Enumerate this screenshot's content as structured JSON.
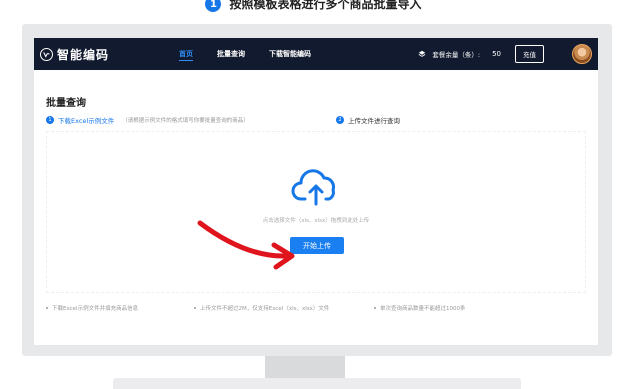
{
  "caption": {
    "number": "1",
    "text": "按照模板表格进行多个商品批量导入"
  },
  "nav": {
    "logo": "智能编码",
    "links": [
      "首页",
      "批量查询",
      "下载智能编码"
    ],
    "active_index": 0,
    "quota_label": "套餐余量（条）:",
    "quota_value": "50",
    "recharge": "充值"
  },
  "page": {
    "title": "批量查询",
    "step1": {
      "num": "1",
      "link": "下载Excel示例文件",
      "hint": "（请根据示例文件的格式填写你要批量查询的商品）"
    },
    "step2": {
      "num": "2",
      "label": "上传文件进行查询"
    },
    "upload_hint": "点击选择文件（xls、xlsx）拖拽到此处上传",
    "upload_button": "开始上传",
    "notes": [
      "下载Excel示例文件并填充商品信息",
      "上传文件不超过2M，仅支持Excel（xls、xlsx）文件",
      "单次查询商品数量不能超过1000条"
    ]
  },
  "colors": {
    "accent": "#1677e8",
    "nav_bg": "#111a2e",
    "arrow": "#e0141d"
  }
}
